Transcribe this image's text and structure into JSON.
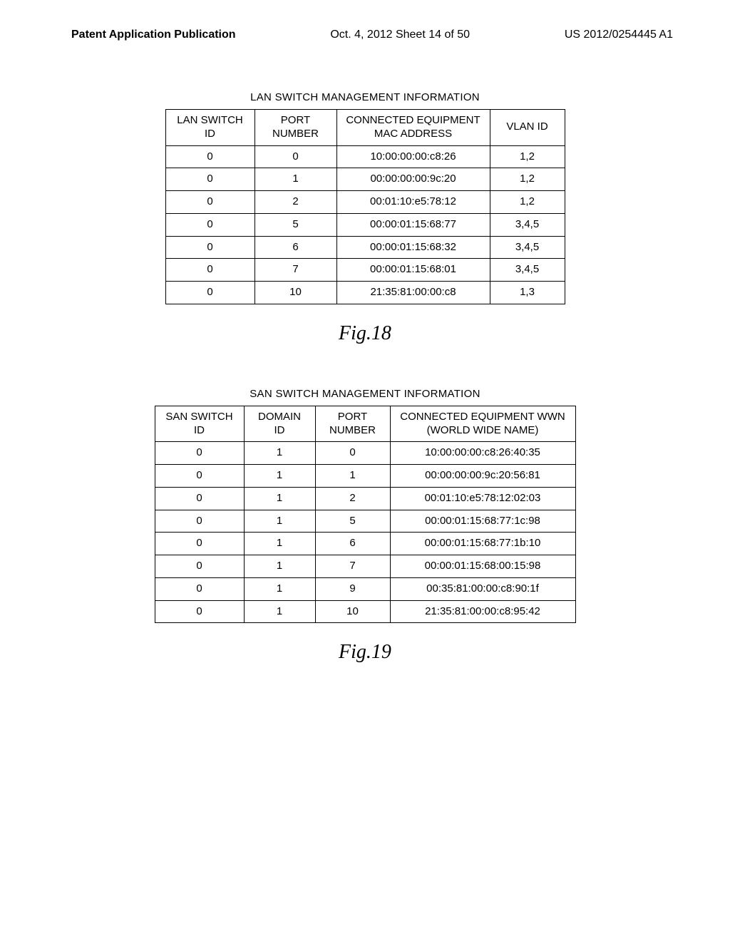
{
  "header": {
    "left": "Patent Application Publication",
    "center": "Oct. 4, 2012   Sheet 14 of 50",
    "right": "US 2012/0254445 A1"
  },
  "lan_section": {
    "title": "LAN SWITCH MANAGEMENT INFORMATION",
    "headers": {
      "c1": "LAN\nSWITCH ID",
      "c2": "PORT\nNUMBER",
      "c3": "CONNECTED\nEQUIPMENT MAC\nADDRESS",
      "c4": "VLAN ID"
    },
    "rows": [
      {
        "c1": "0",
        "c2": "0",
        "c3": "10:00:00:00:c8:26",
        "c4": "1,2"
      },
      {
        "c1": "0",
        "c2": "1",
        "c3": "00:00:00:00:9c:20",
        "c4": "1,2"
      },
      {
        "c1": "0",
        "c2": "2",
        "c3": "00:01:10:e5:78:12",
        "c4": "1,2"
      },
      {
        "c1": "0",
        "c2": "5",
        "c3": "00:00:01:15:68:77",
        "c4": "3,4,5"
      },
      {
        "c1": "0",
        "c2": "6",
        "c3": "00:00:01:15:68:32",
        "c4": "3,4,5"
      },
      {
        "c1": "0",
        "c2": "7",
        "c3": "00:00:01:15:68:01",
        "c4": "3,4,5"
      },
      {
        "c1": "0",
        "c2": "10",
        "c3": "21:35:81:00:00:c8",
        "c4": "1,3"
      }
    ],
    "fig_label": "Fig.18"
  },
  "san_section": {
    "title": "SAN SWITCH MANAGEMENT INFORMATION",
    "headers": {
      "c1": "SAN\nSWITCH ID",
      "c2": "DOMAIN\nID",
      "c3": "PORT\nNUMBER",
      "c4": "CONNECTED EQUIPMENT WWN\n(WORLD WIDE NAME)"
    },
    "rows": [
      {
        "c1": "0",
        "c2": "1",
        "c3": "0",
        "c4": "10:00:00:00:c8:26:40:35"
      },
      {
        "c1": "0",
        "c2": "1",
        "c3": "1",
        "c4": "00:00:00:00:9c:20:56:81"
      },
      {
        "c1": "0",
        "c2": "1",
        "c3": "2",
        "c4": "00:01:10:e5:78:12:02:03"
      },
      {
        "c1": "0",
        "c2": "1",
        "c3": "5",
        "c4": "00:00:01:15:68:77:1c:98"
      },
      {
        "c1": "0",
        "c2": "1",
        "c3": "6",
        "c4": "00:00:01:15:68:77:1b:10"
      },
      {
        "c1": "0",
        "c2": "1",
        "c3": "7",
        "c4": "00:00:01:15:68:00:15:98"
      },
      {
        "c1": "0",
        "c2": "1",
        "c3": "9",
        "c4": "00:35:81:00:00:c8:90:1f"
      },
      {
        "c1": "0",
        "c2": "1",
        "c3": "10",
        "c4": "21:35:81:00:00:c8:95:42"
      }
    ],
    "fig_label": "Fig.19"
  }
}
